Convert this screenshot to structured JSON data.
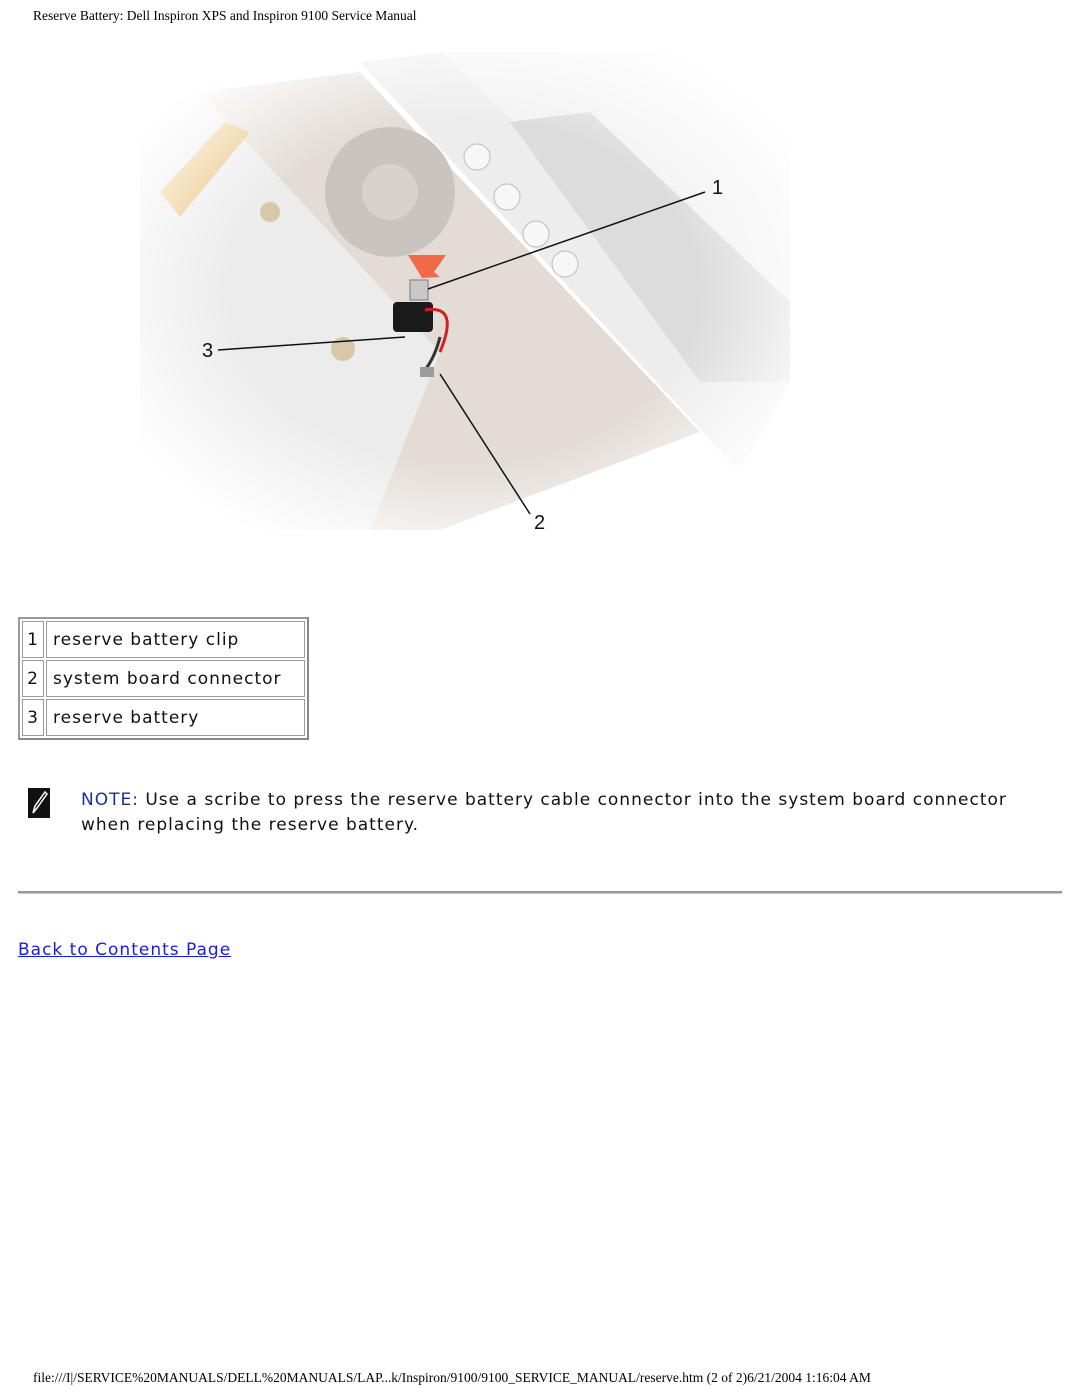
{
  "header": {
    "title": "Reserve Battery: Dell Inspiron XPS and Inspiron 9100 Service Manual"
  },
  "figure": {
    "description": "Illustration of reserve battery being installed into laptop with callouts",
    "callouts": [
      "1",
      "2",
      "3"
    ],
    "colors": {
      "arrow": "#f06a4a",
      "cable_red": "#d42020",
      "ribbon": "#e8b860"
    }
  },
  "legend": {
    "rows": [
      {
        "num": "1",
        "label": "reserve battery clip"
      },
      {
        "num": "2",
        "label": "system board connector"
      },
      {
        "num": "3",
        "label": "reserve battery"
      }
    ]
  },
  "note": {
    "label": "NOTE:",
    "text": " Use a scribe to press the reserve battery cable connector into the system board connector when replacing the reserve battery."
  },
  "navigation": {
    "back_link": "Back to Contents Page"
  },
  "footer": {
    "text": "file:///I|/SERVICE%20MANUALS/DELL%20MANUALS/LAP...k/Inspiron/9100/9100_SERVICE_MANUAL/reserve.htm (2 of 2)6/21/2004 1:16:04 AM"
  }
}
